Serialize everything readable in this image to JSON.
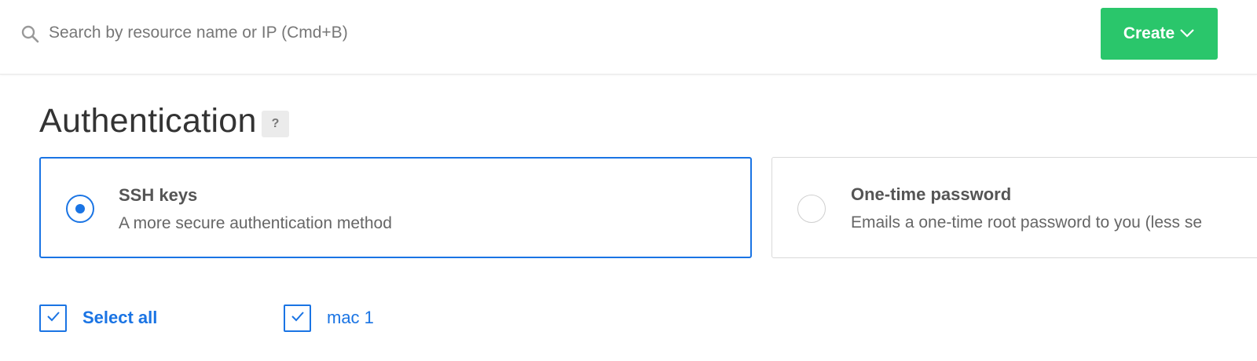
{
  "topbar": {
    "search_placeholder": "Search by resource name or IP (Cmd+B)",
    "search_icon": "search-icon",
    "create_label": "Create",
    "create_icon": "chevron-down-icon",
    "create_color": "#2ac66b"
  },
  "authentication": {
    "title": "Authentication",
    "help_label": "?",
    "accent_color": "#1a74e4",
    "options": [
      {
        "title": "SSH keys",
        "description": "A more secure authentication method",
        "selected": true
      },
      {
        "title": "One-time password",
        "description": "Emails a one-time root password to you (less se",
        "selected": false
      }
    ]
  },
  "ssh_keys": {
    "select_all_label": "Select all",
    "select_all_checked": true,
    "keys": [
      {
        "label": "mac 1",
        "checked": true
      }
    ]
  }
}
